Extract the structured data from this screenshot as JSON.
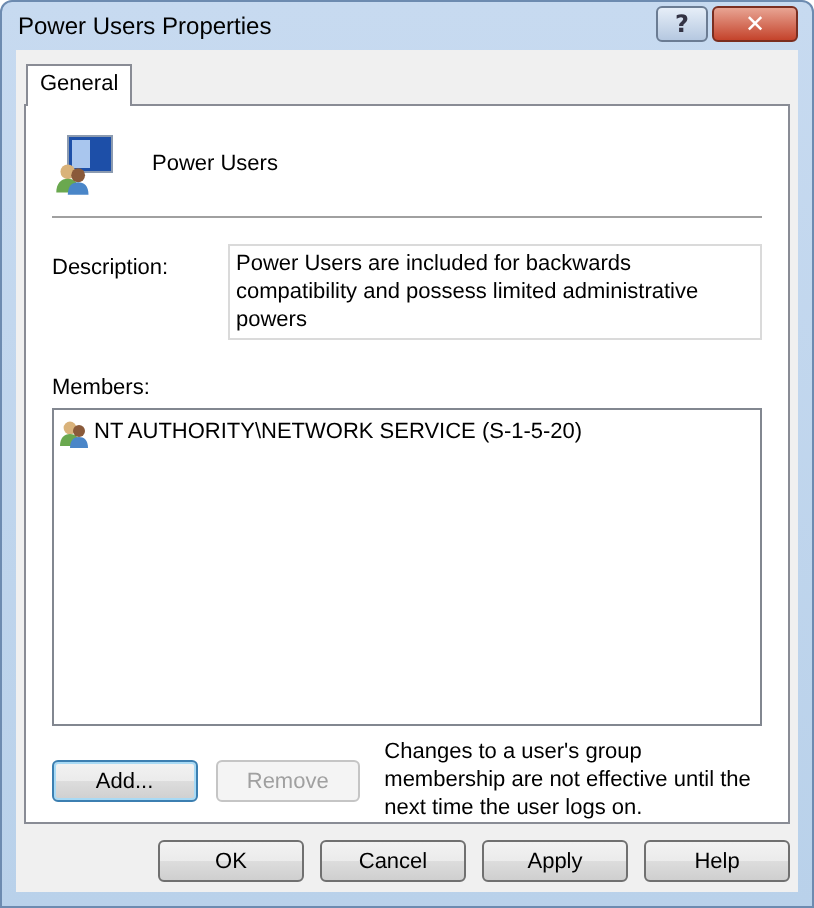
{
  "window": {
    "title": "Power Users Properties",
    "title_buttons": [
      {
        "kind": "help",
        "label": "?"
      },
      {
        "kind": "close",
        "label": "✕"
      }
    ]
  },
  "tabs": [
    {
      "label": "General",
      "selected": true
    }
  ],
  "group": {
    "name": "Power Users"
  },
  "description": {
    "label": "Description:",
    "value": "Power Users are included for backwards compatibility and possess limited administrative powers"
  },
  "members": {
    "label": "Members:",
    "items": [
      "NT AUTHORITY\\NETWORK SERVICE (S-1-5-20)"
    ]
  },
  "member_buttons": [
    {
      "label": "Add...",
      "disabled": false,
      "focused": true
    },
    {
      "label": "Remove",
      "disabled": true,
      "focused": false
    }
  ],
  "note": "Changes to a user's group membership are not effective until the next time the user logs on.",
  "buttons": [
    {
      "label": "OK"
    },
    {
      "label": "Cancel"
    },
    {
      "label": "Apply"
    },
    {
      "label": "Help"
    }
  ]
}
